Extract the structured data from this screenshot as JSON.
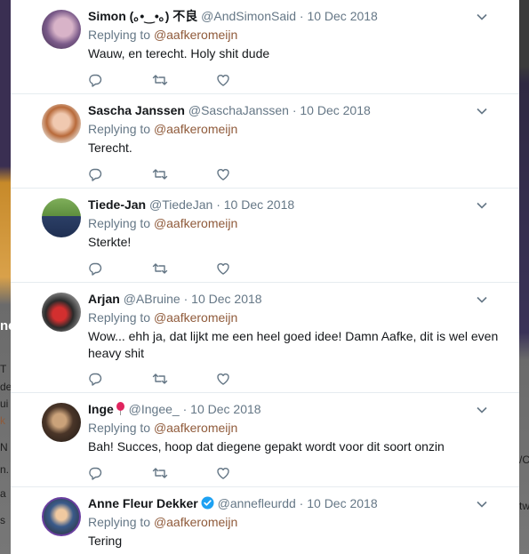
{
  "background": {
    "left_fragments": [
      "ne",
      "T",
      "de",
      "ui",
      "k",
      "N",
      "n.",
      "a",
      "s"
    ],
    "right_fragments": [
      "/C",
      "tw"
    ]
  },
  "tweets": [
    {
      "name": "Simon (｡•‿•｡) 不良",
      "handle": "@AndSimonSaid",
      "sep": "·",
      "date": "10 Dec 2018",
      "replying_label": "Replying to",
      "mention": "@aafkeromeijn",
      "text": "Wauw, en terecht. Holy shit dude"
    },
    {
      "name": "Sascha Janssen",
      "handle": "@SaschaJanssen",
      "sep": "·",
      "date": "10 Dec 2018",
      "replying_label": "Replying to",
      "mention": "@aafkeromeijn",
      "text": "Terecht."
    },
    {
      "name": "Tiede-Jan",
      "handle": "@TiedeJan",
      "sep": "·",
      "date": "10 Dec 2018",
      "replying_label": "Replying to",
      "mention": "@aafkeromeijn",
      "text": "Sterkte!"
    },
    {
      "name": "Arjan",
      "handle": "@ABruine",
      "sep": "·",
      "date": "10 Dec 2018",
      "replying_label": "Replying to",
      "mention": "@aafkeromeijn",
      "text": "Wow... ehh ja, dat lijkt me een heel goed idee! Damn Aafke, dit is wel even heavy shit"
    },
    {
      "name": "Inge",
      "handle": "@Ingee_",
      "sep": "·",
      "date": "10 Dec 2018",
      "replying_label": "Replying to",
      "mention": "@aafkeromeijn",
      "text": "Bah! Succes, hoop dat diegene gepakt wordt voor dit soort onzin"
    },
    {
      "name": "Anne Fleur Dekker",
      "handle": "@annefleurdd",
      "sep": "·",
      "date": "10 Dec 2018",
      "replying_label": "Replying to",
      "mention": "@aafkeromeijn",
      "text": "Tering"
    }
  ],
  "icons": {
    "reply": "reply-icon",
    "retweet": "retweet-icon",
    "like": "heart-icon",
    "more": "chevron-down-icon",
    "verified": "verified-badge-icon",
    "balloon": "balloon-emoji-icon"
  },
  "colors": {
    "name": "#14171a",
    "meta": "#657786",
    "mention": "#8f5a3a",
    "verified": "#1da1f2",
    "divider": "#e6ecf0"
  }
}
